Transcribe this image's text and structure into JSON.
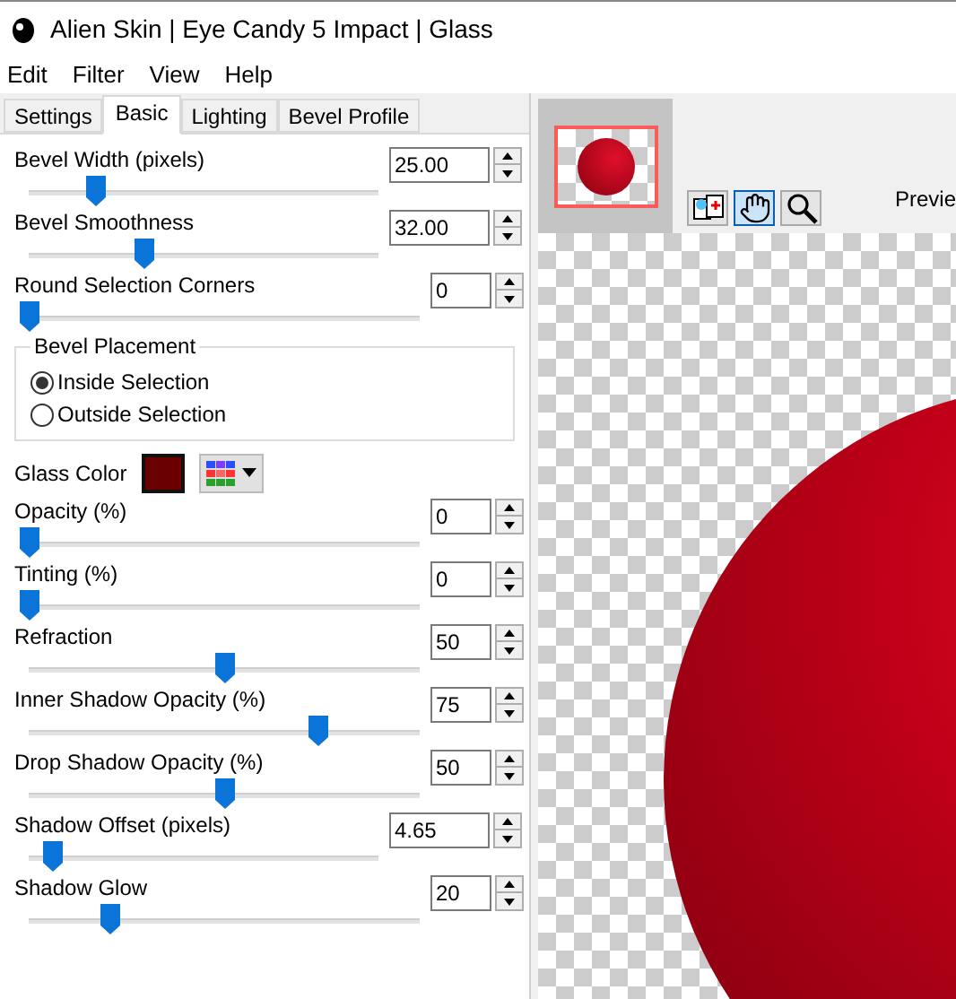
{
  "window": {
    "title": "Alien Skin | Eye Candy 5 Impact | Glass"
  },
  "menu": [
    "Edit",
    "Filter",
    "View",
    "Help"
  ],
  "tabs": [
    {
      "label": "Settings",
      "selected": false
    },
    {
      "label": "Basic",
      "selected": true
    },
    {
      "label": "Lighting",
      "selected": false
    },
    {
      "label": "Bevel Profile",
      "selected": false
    }
  ],
  "sliders_top": [
    {
      "label": "Bevel Width (pixels)",
      "value": "25.00",
      "kind": "decimal",
      "level": 0.19
    },
    {
      "label": "Bevel Smoothness",
      "value": "32.00",
      "kind": "decimal",
      "level": 0.33
    },
    {
      "label": "Round Selection Corners",
      "value": "0",
      "kind": "integer",
      "level": 0
    }
  ],
  "bevel_placement": {
    "title": "Bevel Placement",
    "options": [
      {
        "label": "Inside Selection",
        "selected": true
      },
      {
        "label": "Outside Selection",
        "selected": false
      }
    ]
  },
  "glass_color": {
    "label": "Glass Color",
    "color": "#6b0000"
  },
  "sliders": [
    {
      "label": "Opacity (%)",
      "value": "0",
      "kind": "integer",
      "level": 0
    },
    {
      "label": "Tinting (%)",
      "value": "0",
      "kind": "integer",
      "level": 0
    },
    {
      "label": "Refraction",
      "value": "50",
      "kind": "integer",
      "level": 0.5
    },
    {
      "label": "Inner Shadow Opacity (%)",
      "value": "75",
      "kind": "integer",
      "level": 0.74
    },
    {
      "label": "Drop Shadow Opacity (%)",
      "value": "50",
      "kind": "integer",
      "level": 0.5
    },
    {
      "label": "Shadow Offset (pixels)",
      "value": "4.65",
      "kind": "decimal",
      "level": 0.07
    },
    {
      "label": "Shadow Glow",
      "value": "20",
      "kind": "integer",
      "level": 0.21
    }
  ],
  "preview": {
    "label": "Previe",
    "tools": [
      {
        "kind": "swap",
        "selected": false
      },
      {
        "kind": "hand",
        "selected": true
      },
      {
        "kind": "zoom",
        "selected": false
      }
    ]
  }
}
